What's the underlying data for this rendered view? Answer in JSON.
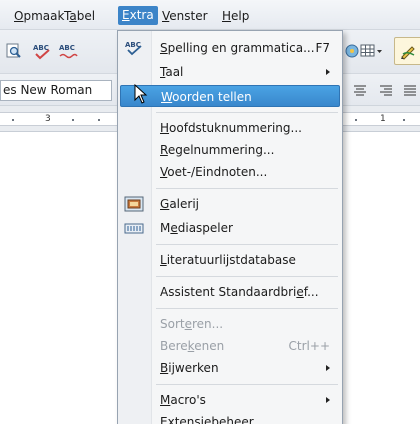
{
  "menubar": {
    "items": [
      {
        "label": "Opmaak",
        "ul": "O",
        "rest": "pmaak"
      },
      {
        "label": "Tabel",
        "ul": "a",
        "pre": "T",
        "rest": "bel"
      },
      {
        "label": "Extra",
        "ul": "E",
        "rest": "xtra"
      },
      {
        "label": "Venster",
        "ul": "V",
        "rest": "enster"
      },
      {
        "label": "Help",
        "ul": "H",
        "rest": "elp"
      }
    ]
  },
  "toolbar2": {
    "font_name": "es New Roman"
  },
  "ruler": {
    "visible_number": "3",
    "visible_number2": "1"
  },
  "menu": {
    "spelling": {
      "label": "Spelling en grammatica...",
      "ul": "S",
      "rest": "pelling en grammatica...",
      "shortcut": "F7"
    },
    "taal": {
      "label": "Taal",
      "ul": "T",
      "rest": "aal"
    },
    "woorden": {
      "label": "Woorden tellen",
      "ul": "W",
      "rest": "oorden tellen"
    },
    "hoofdstuk": {
      "label": "Hoofdstuknummering...",
      "ul": "H",
      "rest": "oofdstuknummering..."
    },
    "regel": {
      "label": "Regelnummering...",
      "ul": "R",
      "rest": "egelnummering..."
    },
    "voet": {
      "label": "Voet-/Eindnoten...",
      "ul": "V",
      "rest": "oet-/Eindnoten..."
    },
    "galerij": {
      "label": "Galerij",
      "ul": "G",
      "rest": "alerij"
    },
    "media": {
      "label": "Mediaspeler",
      "pre": "M",
      "ul": "e",
      "rest": "diaspeler"
    },
    "literatuur": {
      "label": "Literatuurlijstdatabase",
      "ul": "L",
      "rest": "iteratuurlijstdatabase"
    },
    "assistent": {
      "label": "Assistent Standaardbrief...",
      "pre": "Assistent Standaardbri",
      "ul": "e",
      "rest": "f..."
    },
    "sorteren": {
      "label": "Sorteren...",
      "pre": "Sort",
      "ul": "e",
      "rest": "ren..."
    },
    "berekenen": {
      "label": "Berekenen",
      "pre": "Bere",
      "ul": "k",
      "rest": "enen",
      "shortcut": "Ctrl++"
    },
    "bijwerken": {
      "label": "Bijwerken",
      "ul": "B",
      "rest": "ijwerken"
    },
    "macros": {
      "label": "Macro's",
      "ul": "M",
      "rest": "acro's"
    },
    "extensie": {
      "label": "Extensiebeheer...",
      "ul": "x",
      "pre": "E",
      "rest": "tensiebeheer..."
    }
  },
  "icons": {
    "spellcheck": "spellcheck-icon",
    "galerij": "gallery-icon",
    "media": "media-player-icon"
  },
  "colors": {
    "highlight": "#3c84c8",
    "menu_bg": "#f5f6f7",
    "disabled": "#9aa0a7"
  }
}
